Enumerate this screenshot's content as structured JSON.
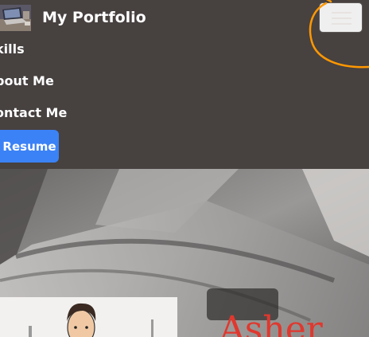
{
  "navbar": {
    "brand_text": "My Portfolio",
    "brand_image": "laptop-desk-thumbnail",
    "toggler_icon": "hamburger-menu-icon",
    "links": [
      {
        "label": "kills"
      },
      {
        "label": "bout Me"
      },
      {
        "label": "ontact Me"
      }
    ],
    "resume_label": "Resume"
  },
  "hero": {
    "background_image": "grayscale-laptop-keyboard-photo",
    "avatar_image": "cartoon-avatar-illustration",
    "name_text": "Asher"
  },
  "colors": {
    "navbar_bg": "#474140",
    "resume_button": "#3b82f6",
    "annotation_circle": "#ff9800",
    "hero_name": "#e0382e"
  }
}
